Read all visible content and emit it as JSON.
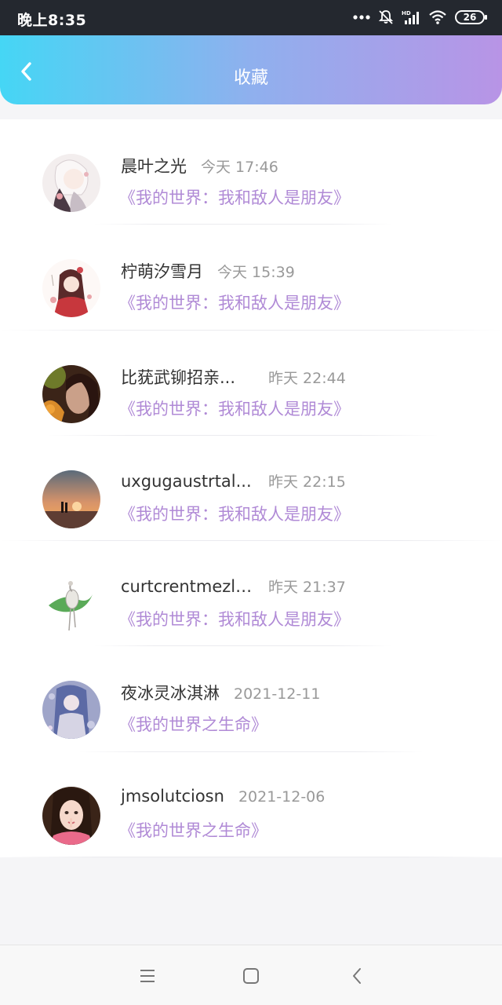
{
  "status_bar": {
    "time": "晚上8:35",
    "battery": "26"
  },
  "header": {
    "title": "收藏"
  },
  "favorites": [
    {
      "user": "晨叶之光",
      "time": "今天 17:46",
      "book": "《我的世界：我和敌人是朋友》"
    },
    {
      "user": "柠萌汐雪月",
      "time": "今天 15:39",
      "book": "《我的世界：我和敌人是朋友》"
    },
    {
      "user": "比莸武铆招亲...",
      "time": "昨天 22:44",
      "book": "《我的世界：我和敌人是朋友》"
    },
    {
      "user": "uxgugaustrtal...",
      "time": "昨天 22:15",
      "book": "《我的世界：我和敌人是朋友》"
    },
    {
      "user": "curtcrentmezlli...",
      "time": "昨天 21:37",
      "book": "《我的世界：我和敌人是朋友》"
    },
    {
      "user": "夜冰灵冰淇淋",
      "time": "2021-12-11",
      "book": "《我的世界之生命》"
    },
    {
      "user": "jmsolutciosn",
      "time": "2021-12-06",
      "book": "《我的世界之生命》"
    }
  ]
}
